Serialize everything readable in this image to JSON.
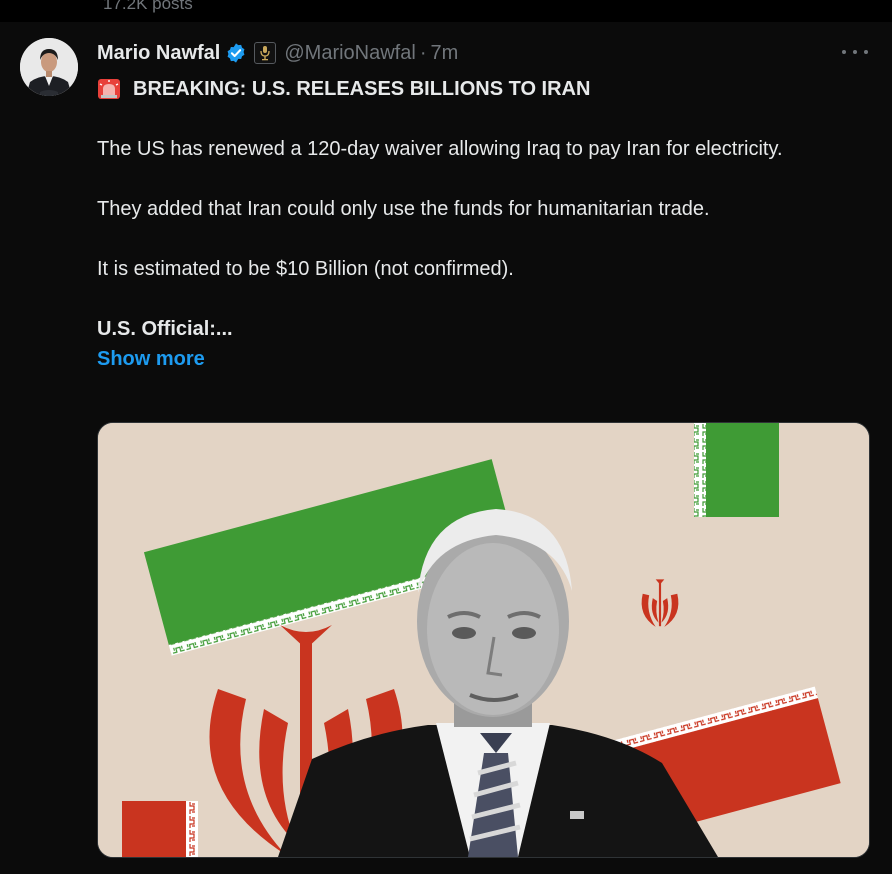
{
  "header": {
    "post_count": "17.2K posts"
  },
  "tweet": {
    "author_name": "Mario Nawfal",
    "handle": "@MarioNawfal",
    "separator": "·",
    "time": "7m",
    "headline_icon": "siren-emoji",
    "headline": "BREAKING: U.S. RELEASES BILLIONS TO IRAN",
    "paragraphs": [
      "The US has renewed a 120-day waiver allowing Iraq to pay Iran for electricity.",
      "They added that Iran could only use the funds for humanitarian trade.",
      "It is estimated to be $10 Billion (not confirmed)."
    ],
    "truncated_line": "U.S. Official:...",
    "show_more": "Show more"
  },
  "icons": {
    "verified": "verified-badge-icon",
    "affiliate": "affiliate-badge-icon",
    "more": "more-options-icon"
  },
  "colors": {
    "background": "#0b0b0b",
    "text": "#e7e9ea",
    "muted": "#71767b",
    "link": "#1d9bf0",
    "verified": "#1d9bf0",
    "flag_green": "#3f9b35",
    "flag_red": "#c9341f",
    "media_bg": "#e3d4c5"
  }
}
